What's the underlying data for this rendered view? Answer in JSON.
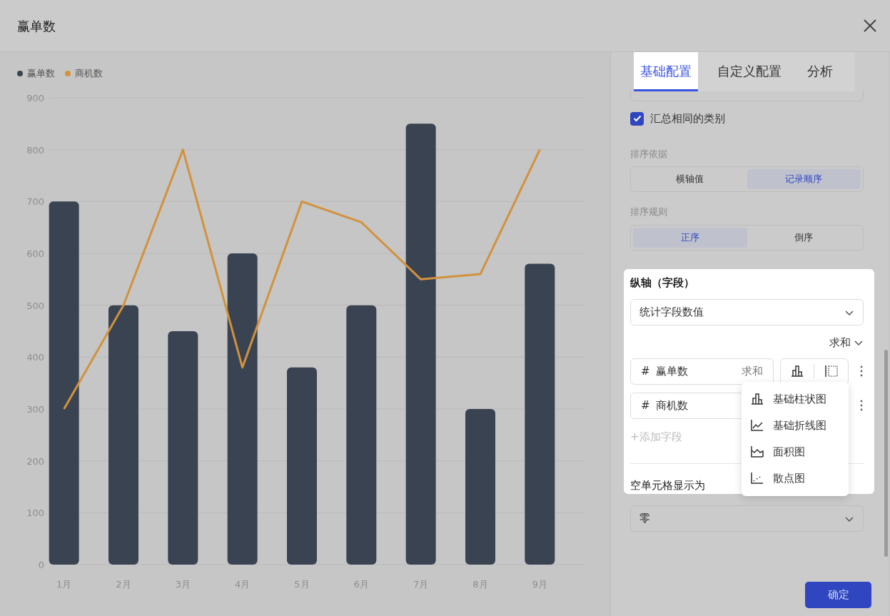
{
  "dialog": {
    "title": "赢单数"
  },
  "chart": {
    "chart_data": {
      "type": "bar",
      "grid": true,
      "categories": [
        "1月",
        "2月",
        "3月",
        "4月",
        "5月",
        "6月",
        "7月",
        "8月",
        "9月"
      ],
      "ylim": [
        0,
        900
      ],
      "yticks": [
        0,
        100,
        200,
        300,
        400,
        500,
        600,
        700,
        800,
        900
      ],
      "series": [
        {
          "name": "赢单数",
          "color": "#3a4352",
          "values": [
            700,
            500,
            450,
            600,
            380,
            500,
            850,
            300,
            580
          ]
        },
        {
          "name": "商机数",
          "type": "line",
          "color": "#d2923c",
          "values": [
            300,
            500,
            800,
            380,
            700,
            660,
            550,
            560,
            800
          ]
        }
      ]
    }
  },
  "tabs": [
    {
      "label": "基础配置",
      "selected": true
    },
    {
      "label": "自定义配置",
      "selected": false
    },
    {
      "label": "分析",
      "selected": false
    }
  ],
  "aggregate_same": {
    "label": "汇总相同的类别",
    "checked": true
  },
  "sort_basis": {
    "label": "排序依据",
    "options": [
      {
        "label": "横轴值",
        "selected": false
      },
      {
        "label": "记录顺序",
        "selected": true
      }
    ]
  },
  "sort_order": {
    "label": "排序规则",
    "options": [
      {
        "label": "正序",
        "selected": true
      },
      {
        "label": "倒序",
        "selected": false
      }
    ]
  },
  "y_axis": {
    "spotlight": true,
    "title": "纵轴（字段）",
    "select_value": "统计字段数值",
    "aggregate": "求和",
    "fields": [
      {
        "symbol": "#",
        "name": "赢单数",
        "aggregate": "求和",
        "chart_buttons": true
      },
      {
        "symbol": "#",
        "name": "商机数",
        "chart_buttons": false
      }
    ],
    "add_field": "+添加字段"
  },
  "chart_type_menu": [
    {
      "label": "基础柱状图",
      "kind": "bar"
    },
    {
      "label": "基础折线图",
      "kind": "line"
    },
    {
      "label": "面积图",
      "kind": "area"
    },
    {
      "label": "散点图",
      "kind": "scatter"
    }
  ],
  "empty_cell": {
    "label": "空单元格显示为",
    "value": "零"
  },
  "confirm_button": "确定"
}
